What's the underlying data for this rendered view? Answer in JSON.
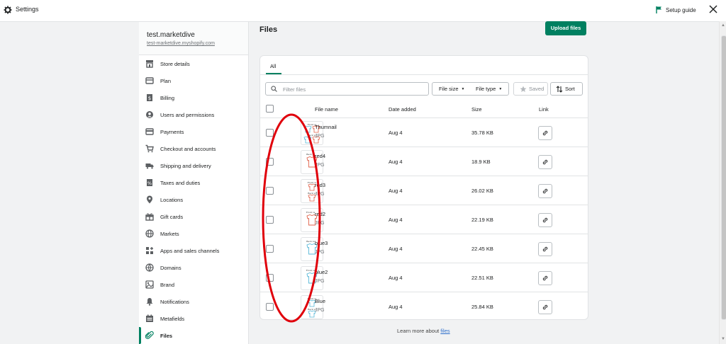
{
  "topbar": {
    "title": "Settings",
    "setup_guide": "Setup guide"
  },
  "store": {
    "name": "test.marketdive",
    "url": "test-marketdive.myshopify.com"
  },
  "sidebar": {
    "items": [
      {
        "label": "Store details",
        "icon": "store-icon"
      },
      {
        "label": "Plan",
        "icon": "plan-icon"
      },
      {
        "label": "Billing",
        "icon": "billing-icon"
      },
      {
        "label": "Users and permissions",
        "icon": "users-icon"
      },
      {
        "label": "Payments",
        "icon": "payments-icon"
      },
      {
        "label": "Checkout and accounts",
        "icon": "cart-icon"
      },
      {
        "label": "Shipping and delivery",
        "icon": "truck-icon"
      },
      {
        "label": "Taxes and duties",
        "icon": "tax-icon"
      },
      {
        "label": "Locations",
        "icon": "location-icon"
      },
      {
        "label": "Gift cards",
        "icon": "gift-icon"
      },
      {
        "label": "Markets",
        "icon": "globe-icon"
      },
      {
        "label": "Apps and sales channels",
        "icon": "apps-icon"
      },
      {
        "label": "Domains",
        "icon": "domains-icon"
      },
      {
        "label": "Brand",
        "icon": "brand-icon"
      },
      {
        "label": "Notifications",
        "icon": "bell-icon"
      },
      {
        "label": "Metafields",
        "icon": "metafields-icon"
      },
      {
        "label": "Files",
        "icon": "paperclip-icon"
      }
    ]
  },
  "main": {
    "title": "Files",
    "upload_label": "Upload files",
    "tab_all": "All",
    "filter_placeholder": "Filter files",
    "file_size_label": "File size",
    "file_type_label": "File type",
    "saved_label": "Saved",
    "sort_label": "Sort",
    "columns": {
      "name": "File name",
      "date": "Date added",
      "size": "Size",
      "link": "Link"
    },
    "files": [
      {
        "name": "Thumnail",
        "type": "JPG",
        "date": "Aug 4",
        "size": "35.78 KB"
      },
      {
        "name": "red4",
        "type": "JPG",
        "date": "Aug 4",
        "size": "18.9 KB"
      },
      {
        "name": "red3",
        "type": "JPG",
        "date": "Aug 4",
        "size": "26.02 KB"
      },
      {
        "name": "red2",
        "type": "JPG",
        "date": "Aug 4",
        "size": "22.19 KB"
      },
      {
        "name": "blue3",
        "type": "JPG",
        "date": "Aug 4",
        "size": "22.45 KB"
      },
      {
        "name": "blue2",
        "type": "JPG",
        "date": "Aug 4",
        "size": "22.51 KB"
      },
      {
        "name": "Blue",
        "type": "JPG",
        "date": "Aug 4",
        "size": "25.84 KB"
      }
    ],
    "learn_prefix": "Learn more about ",
    "learn_link": "files"
  },
  "colors": {
    "accent": "#008060",
    "annotation": "#e0000b",
    "link": "#2c6ecb"
  }
}
